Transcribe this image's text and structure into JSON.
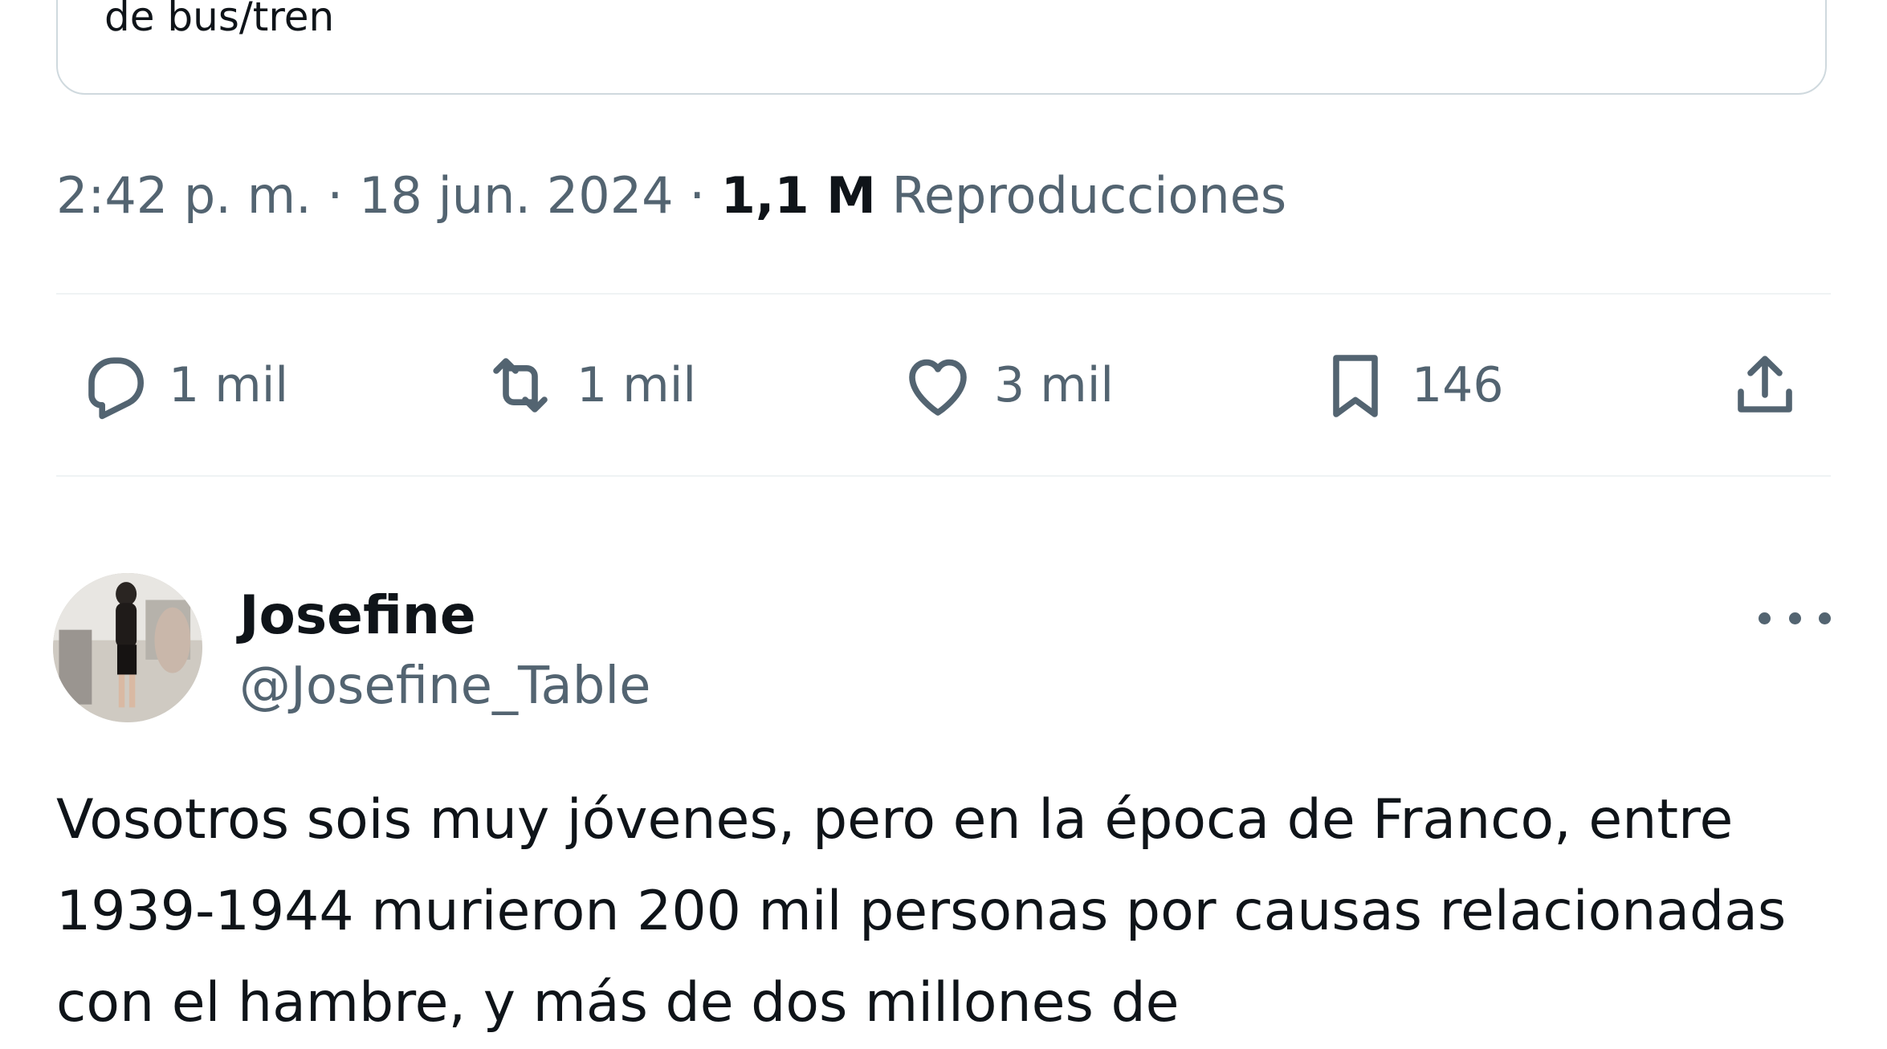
{
  "quoted_tweet": {
    "text_fragment": "de bus/tren"
  },
  "tweet_meta": {
    "time": "2:42 p. m.",
    "separator": "·",
    "date": "18 jun. 2024",
    "views_count": "1,1 M",
    "views_label": "Reproducciones"
  },
  "actions": {
    "reply": {
      "icon": "reply-icon",
      "count": "1 mil"
    },
    "retweet": {
      "icon": "retweet-icon",
      "count": "1 mil"
    },
    "like": {
      "icon": "heart-icon",
      "count": "3 mil"
    },
    "bookmark": {
      "icon": "bookmark-icon",
      "count": "146"
    },
    "share": {
      "icon": "share-icon"
    }
  },
  "reply": {
    "display_name": "Josefine",
    "handle": "@Josefine_Table",
    "text": "Vosotros sois muy jóvenes, pero en la época de Franco, entre 1939-1944 murieron 200 mil personas por causas relacionadas con el hambre, y más de dos millones de"
  },
  "colors": {
    "primary_text": "#0f1419",
    "secondary_text": "#536471",
    "divider": "#eff3f4",
    "card_border": "#cfd9de"
  }
}
